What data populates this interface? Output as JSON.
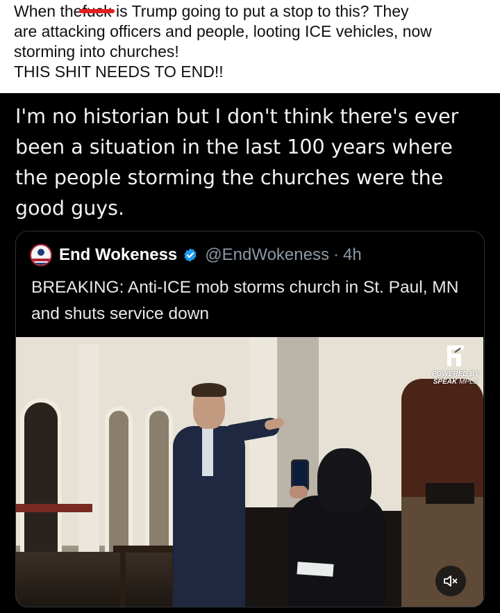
{
  "caption": {
    "prefix": "When the",
    "censored_word": "fuck",
    "line1_rest": " is Trump going to put a stop to this? They",
    "line2": "are attacking officers and people, looting ICE vehicles, now",
    "line3": "storming into churches!",
    "line4": "THIS SHIT NEEDS TO END!!"
  },
  "meme": {
    "text": "I'm no historian but I don't think there's ever been a situation in the last 100 years where the people storming the churches were the good guys."
  },
  "tweet": {
    "display_name": "End Wokeness",
    "handle": "@EndWokeness",
    "separator": "·",
    "time": "4h",
    "body": "BREAKING: Anti-ICE mob storms church in St. Paul, MN and shuts service down",
    "verified_color": "#1d9bf0",
    "video": {
      "overlay_brand": "POWERED BY",
      "overlay_brand_name": "SPEAK",
      "overlay_brand_suffix": "MPLS",
      "mute_icon": "speaker-muted-icon"
    }
  },
  "colors": {
    "meme_background": "#000000",
    "caption_background": "#ffffff",
    "censor_mark": "#e02020",
    "handle_gray": "#8b98a5"
  }
}
